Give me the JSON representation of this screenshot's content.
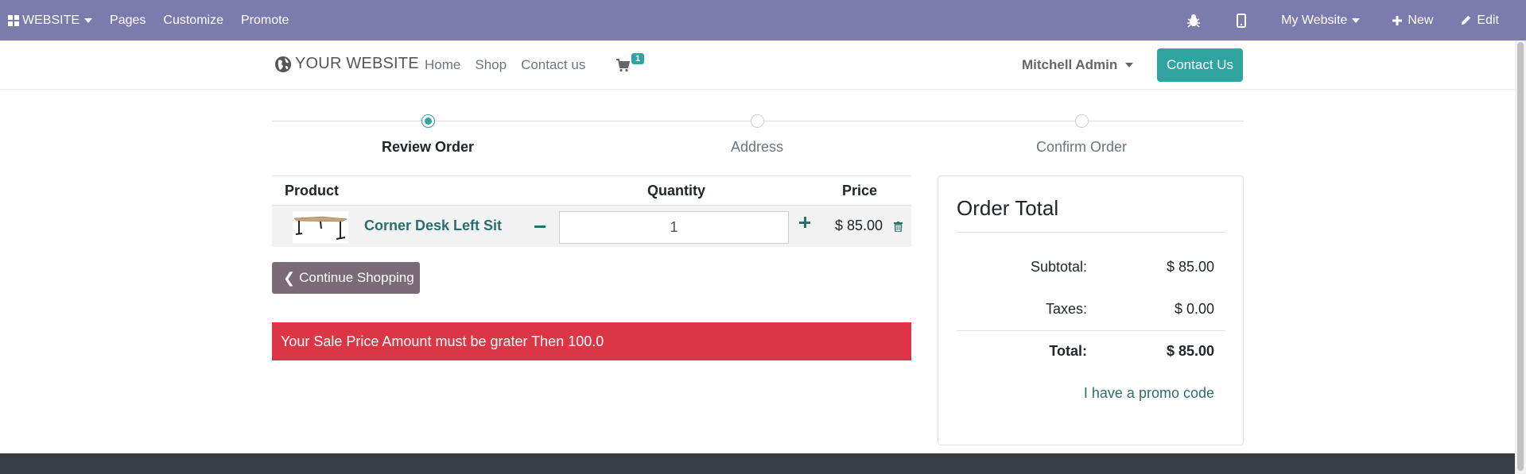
{
  "admin_bar": {
    "website_menu": "WEBSITE",
    "pages": "Pages",
    "customize": "Customize",
    "promote": "Promote",
    "site_selector": "My Website",
    "new_label": "New",
    "edit_label": "Edit",
    "bg_color": "#7c7bad"
  },
  "header": {
    "logo_text": "YOUR WEBSITE",
    "nav": [
      "Home",
      "Shop",
      "Contact us"
    ],
    "cart_count": "1",
    "user": "Mitchell Admin",
    "contact_button": "Contact Us",
    "accent_color": "#2fa5a2"
  },
  "wizard": {
    "steps": [
      "Review Order",
      "Address",
      "Confirm Order"
    ],
    "active_step": "Review Order"
  },
  "cart": {
    "headers": {
      "product": "Product",
      "quantity": "Quantity",
      "price": "Price"
    },
    "items": [
      {
        "name": "Corner Desk Left Sit",
        "quantity": "1",
        "price": "$ 85.00"
      }
    ],
    "continue_button": "Continue Shopping",
    "alert": "Your Sale Price Amount must be grater Then 100.0"
  },
  "order_total": {
    "title": "Order Total",
    "subtotal_label": "Subtotal:",
    "subtotal_value": "$ 85.00",
    "taxes_label": "Taxes:",
    "taxes_value": "$ 0.00",
    "total_label": "Total:",
    "total_value": "$ 85.00",
    "promo_link": "I have a promo code"
  }
}
